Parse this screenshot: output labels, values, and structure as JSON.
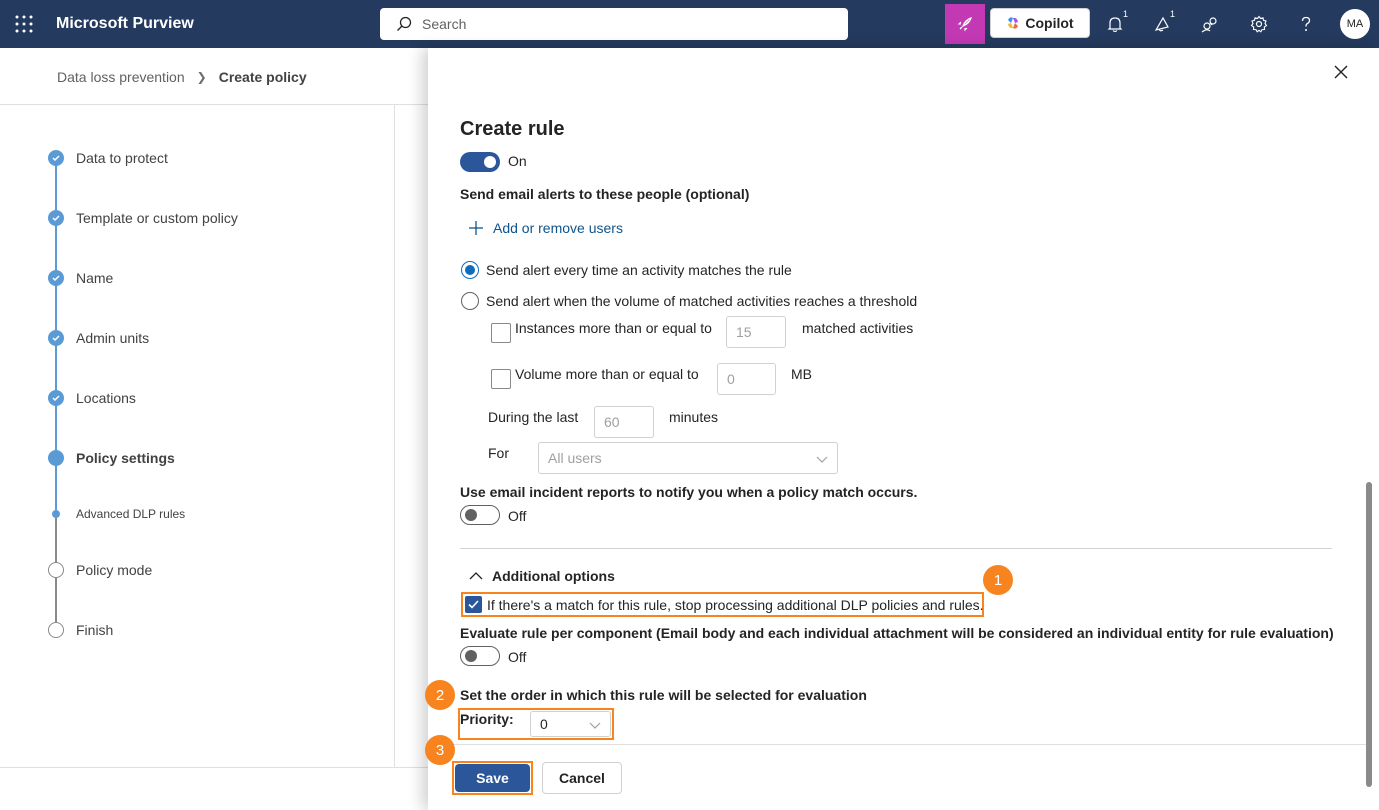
{
  "app": {
    "title": "Microsoft Purview",
    "search_placeholder": "Search",
    "copilot_label": "Copilot",
    "notification_count": "1",
    "whats_new_count": "1",
    "avatar_initials": "MA"
  },
  "breadcrumb": {
    "parent": "Data loss prevention",
    "current": "Create policy"
  },
  "steps": [
    {
      "label": "Data to protect",
      "state": "done"
    },
    {
      "label": "Template or custom policy",
      "state": "done"
    },
    {
      "label": "Name",
      "state": "done"
    },
    {
      "label": "Admin units",
      "state": "done"
    },
    {
      "label": "Locations",
      "state": "done"
    },
    {
      "label": "Policy settings",
      "state": "current"
    },
    {
      "label": "Advanced DLP rules",
      "state": "sub"
    },
    {
      "label": "Policy mode",
      "state": "todo"
    },
    {
      "label": "Finish",
      "state": "todo"
    }
  ],
  "panel": {
    "title": "Create rule",
    "admin_alert_toggle_label": "On",
    "email_alerts_heading": "Send email alerts to these people (optional)",
    "add_users_label": "Add or remove users",
    "radio_every_time": "Send alert every time an activity matches the rule",
    "radio_threshold": "Send alert when the volume of matched activities reaches a threshold",
    "instances_label": "Instances more than or equal to",
    "instances_value": "15",
    "instances_suffix": "matched activities",
    "volume_label": "Volume more than or equal to",
    "volume_value": "0",
    "volume_suffix": "MB",
    "during_label": "During the last",
    "during_value": "60",
    "during_suffix": "minutes",
    "for_label": "For",
    "for_value": "All users",
    "incident_heading": "Use email incident reports to notify you when a policy match occurs.",
    "incident_toggle_label": "Off",
    "additional_options_label": "Additional options",
    "stop_processing_label": "If there's a match for this rule, stop processing additional DLP policies and rules.",
    "evaluate_heading": "Evaluate rule per component (Email body and each individual attachment will be considered an individual entity for rule evaluation)",
    "evaluate_toggle_label": "Off",
    "order_heading": "Set the order in which this rule will be selected for evaluation",
    "priority_label": "Priority:",
    "priority_value": "0",
    "save_label": "Save",
    "cancel_label": "Cancel"
  },
  "callouts": [
    "1",
    "2",
    "3"
  ],
  "colors": {
    "topbar": "#243a5e",
    "accent": "#2b579a",
    "step_done": "#5b9bd5",
    "highlight": "#f7841f",
    "rocket": "#c239b3"
  }
}
